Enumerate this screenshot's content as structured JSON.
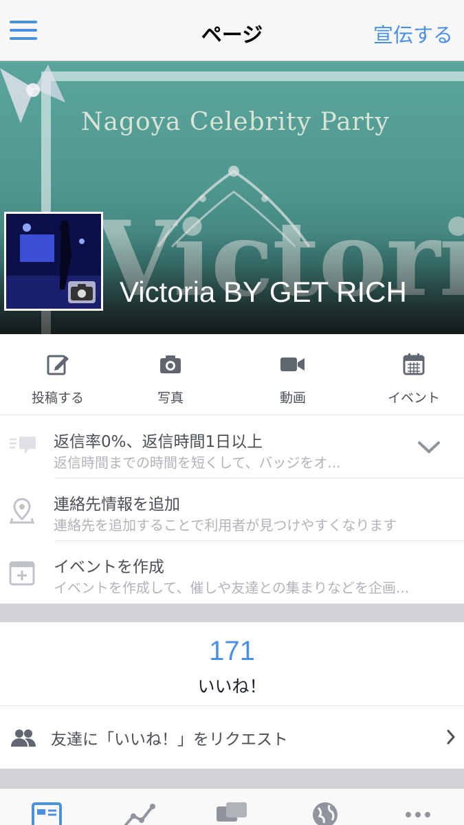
{
  "nav": {
    "title": "ページ",
    "right_action": "宣伝する",
    "accent": "#4a90e2"
  },
  "cover": {
    "banner_title": "Nagoya Celebrity Party",
    "banner_big": "Victoria",
    "page_name": "Victoria BY GET RICH"
  },
  "actions": [
    {
      "label": "投稿する",
      "icon": "compose-icon"
    },
    {
      "label": "写真",
      "icon": "camera-icon"
    },
    {
      "label": "動画",
      "icon": "video-icon"
    },
    {
      "label": "イベント",
      "icon": "calendar-icon"
    }
  ],
  "info": [
    {
      "title": "返信率0%、返信時間1日以上",
      "subtitle": "返信時間までの時間を短くして、バッジをオ...",
      "icon": "message-icon"
    },
    {
      "title": "連絡先情報を追加",
      "subtitle": "連絡先を追加することで利用者が見つけやすくなります",
      "icon": "location-pin-icon"
    },
    {
      "title": "イベントを作成",
      "subtitle": "イベントを作成して、催しや友達との集まりなどを企画...",
      "icon": "add-event-icon"
    }
  ],
  "likes": {
    "count": "171",
    "label": "いいね！"
  },
  "invite": {
    "label": "友達に「いいね！」をリクエスト"
  },
  "tabs": [
    {
      "icon": "page-icon",
      "active": true
    },
    {
      "icon": "insights-icon",
      "active": false
    },
    {
      "icon": "messages-icon",
      "active": false
    },
    {
      "icon": "globe-icon",
      "active": false
    },
    {
      "icon": "more-icon",
      "active": false
    }
  ]
}
